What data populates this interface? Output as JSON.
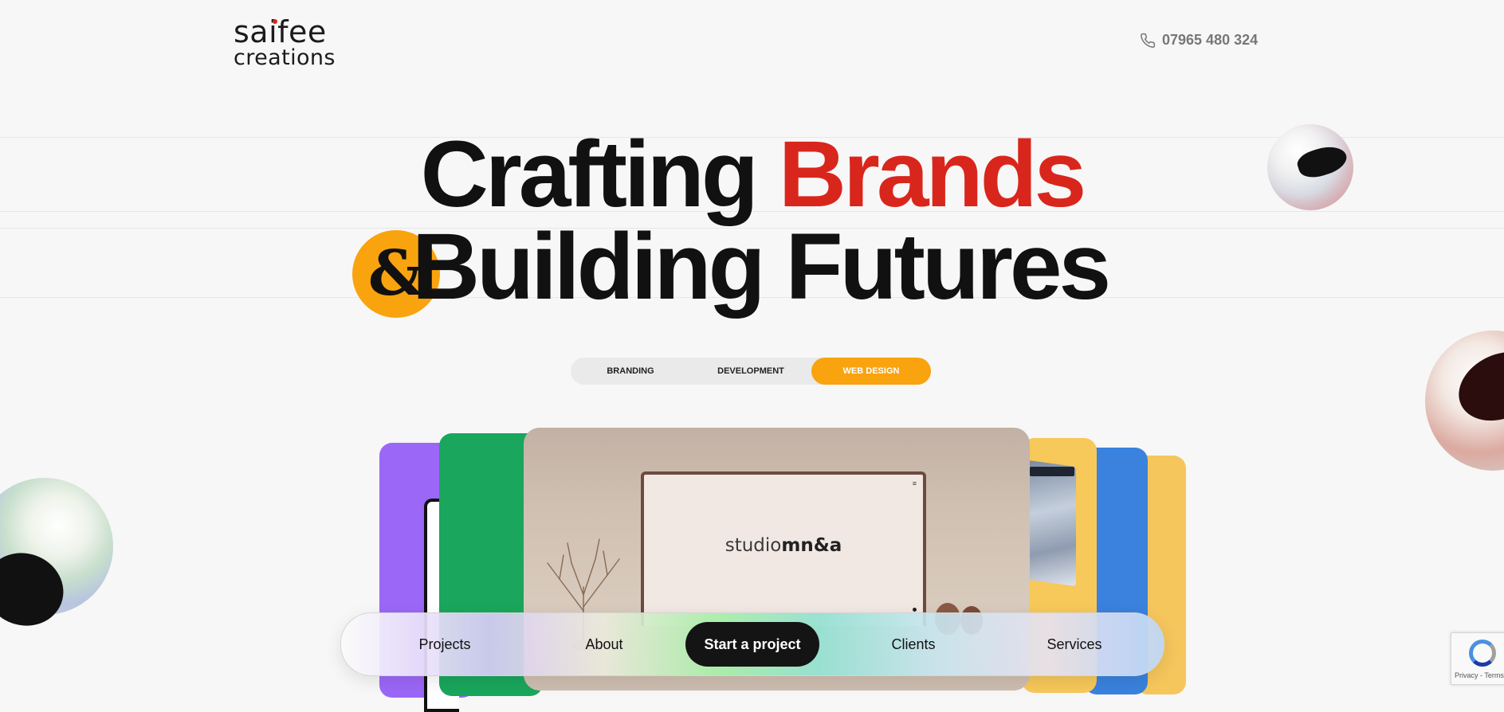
{
  "brand": {
    "logo_line1": "saifee",
    "logo_line2": "creations"
  },
  "header": {
    "phone": "07965 480 324"
  },
  "hero": {
    "line1_prefix": "Crafting ",
    "line1_accent": "Brands",
    "ampersand": "&",
    "line2": "Building Futures"
  },
  "tabs": [
    {
      "label": "BRANDING",
      "active": false
    },
    {
      "label": "DEVELOPMENT",
      "active": false
    },
    {
      "label": "WEB DESIGN",
      "active": true
    }
  ],
  "showcase": {
    "studio_light": "studio",
    "studio_bold": "mn&a",
    "menu_glyph": "≡"
  },
  "nav": {
    "projects": "Projects",
    "about": "About",
    "cta": "Start a project",
    "clients": "Clients",
    "services": "Services"
  },
  "recaptcha": {
    "links": "Privacy - Terms"
  },
  "colors": {
    "accent_red": "#d9261c",
    "accent_orange": "#f9a30f",
    "dark": "#141414"
  },
  "icons": [
    "phone-icon",
    "menu-icon",
    "recaptcha-icon"
  ]
}
